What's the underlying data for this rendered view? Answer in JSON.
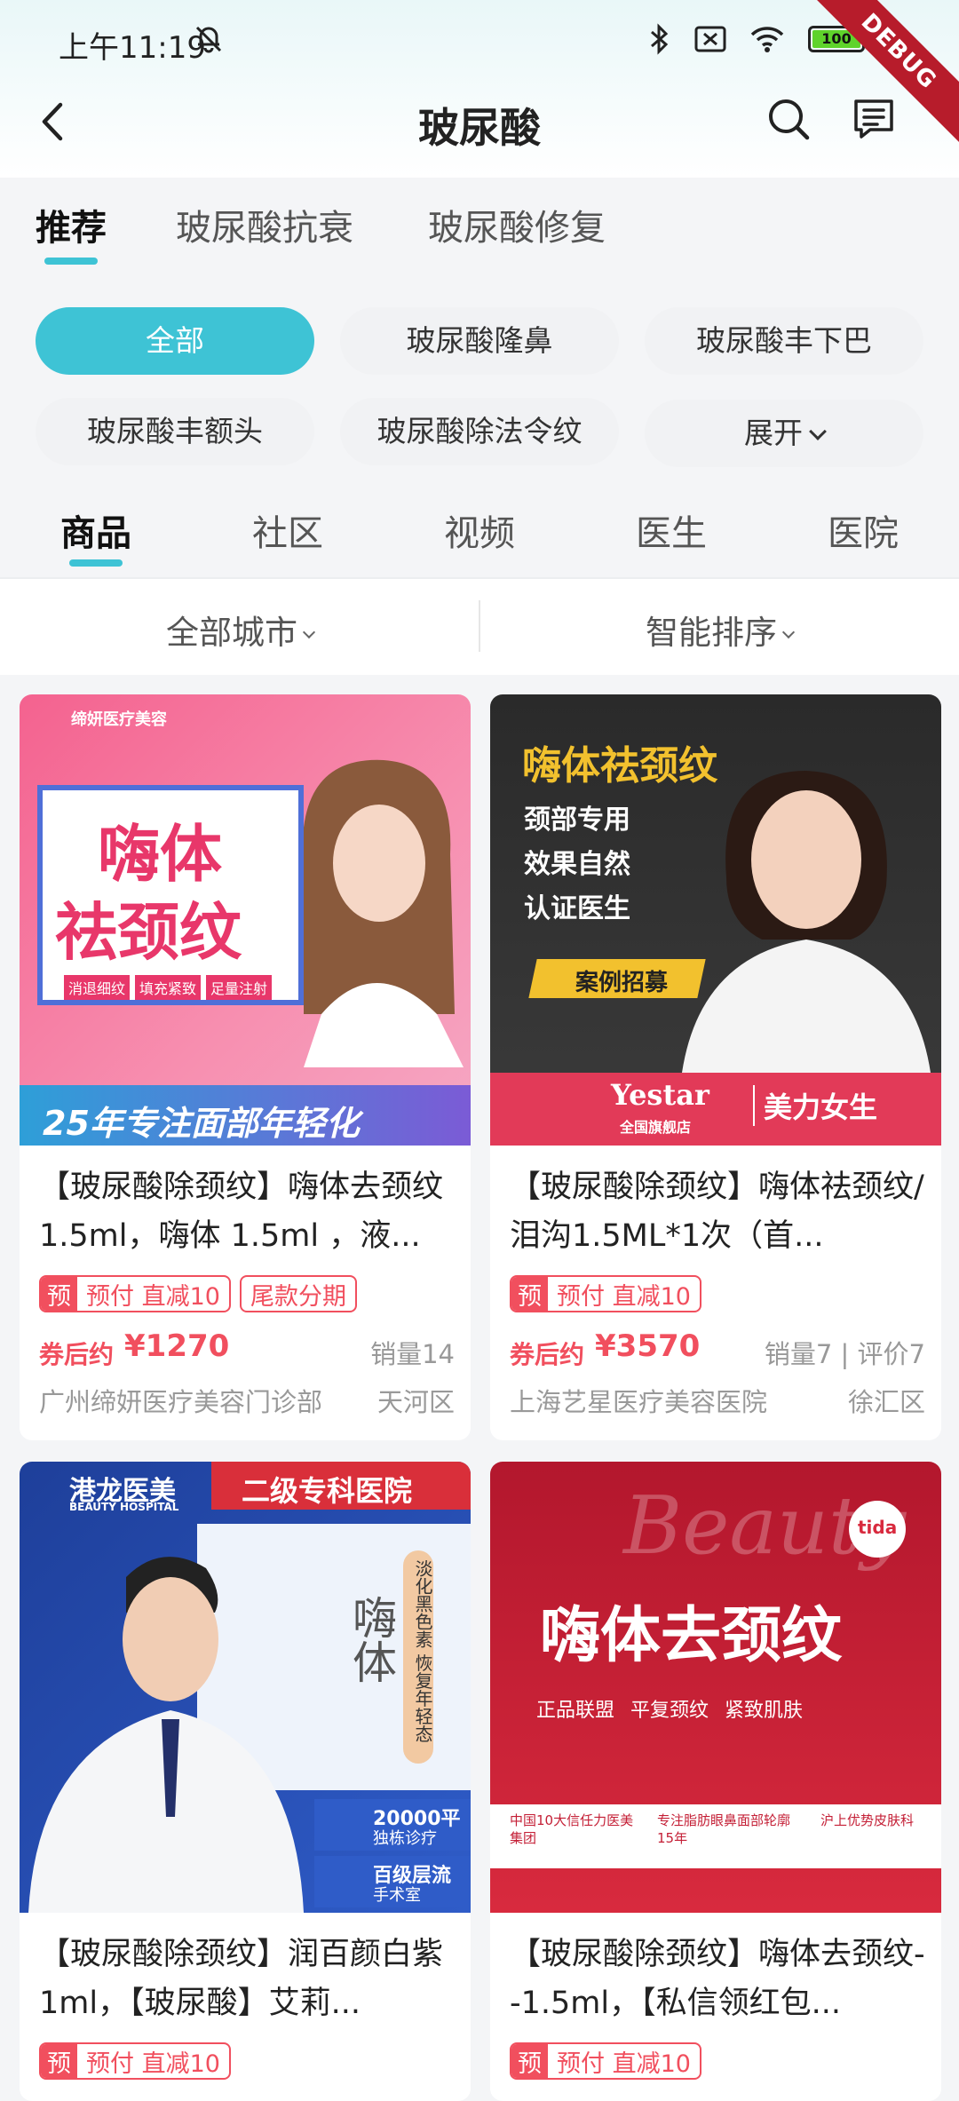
{
  "status_bar": {
    "time": "上午11:19",
    "battery": "100",
    "debug_label": "DEBUG"
  },
  "nav": {
    "title": "玻尿酸"
  },
  "category_tabs": [
    {
      "label": "推荐",
      "active": true
    },
    {
      "label": "玻尿酸抗衰",
      "active": false
    },
    {
      "label": "玻尿酸修复",
      "active": false
    }
  ],
  "chips": [
    {
      "label": "全部",
      "active": true
    },
    {
      "label": "玻尿酸隆鼻",
      "active": false
    },
    {
      "label": "玻尿酸丰下巴",
      "active": false
    },
    {
      "label": "玻尿酸丰额头",
      "active": false
    },
    {
      "label": "玻尿酸除法令纹",
      "active": false
    },
    {
      "label": "展开",
      "active": false
    }
  ],
  "sub_tabs": [
    {
      "label": "商品",
      "active": true
    },
    {
      "label": "社区",
      "active": false
    },
    {
      "label": "视频",
      "active": false
    },
    {
      "label": "医生",
      "active": false
    },
    {
      "label": "医院",
      "active": false
    }
  ],
  "filters": {
    "city": "全部城市",
    "sort": "智能排序"
  },
  "colors": {
    "accent": "#3ec3d5",
    "price": "#f14f5e"
  },
  "products": [
    {
      "title": "【玻尿酸除颈纹】嗨体去颈纹1.5ml，嗨体 1.5ml ，液...",
      "tags": [
        {
          "prefix": "预",
          "text": "预付 直减10"
        },
        {
          "prefix": "",
          "text": "尾款分期"
        }
      ],
      "coupon_label": "券后约",
      "price": "¥1270",
      "sales": "销量14",
      "hospital": "广州缔妍医疗美容门诊部",
      "area": "天河区",
      "image_texts": {
        "brand": "缔妍医疗美容",
        "headline1": "嗨体",
        "headline2": "祛颈纹",
        "badges": [
          "消退细纹",
          "填充紧致",
          "足量注射"
        ],
        "footer": "25年专注面部年轻化"
      }
    },
    {
      "title": "【玻尿酸除颈纹】嗨体祛颈纹/泪沟1.5ML*1次（首...",
      "tags": [
        {
          "prefix": "预",
          "text": "预付 直减10"
        }
      ],
      "coupon_label": "券后约",
      "price": "¥3570",
      "sales": "销量7 | 评价7",
      "hospital": "上海艺星医疗美容医院",
      "area": "徐汇区",
      "image_texts": {
        "headline": "嗨体祛颈纹",
        "lines": [
          "颈部专用",
          "效果自然",
          "认证医生"
        ],
        "badge": "案例招募",
        "brand": "Yestar",
        "brand_sub": "全国旗舰店",
        "slogan": "美力女生"
      }
    },
    {
      "title": "【玻尿酸除颈纹】润百颜白紫 1ml，【玻尿酸】艾莉...",
      "tags": [
        {
          "prefix": "预",
          "text": "预付 直减10"
        }
      ],
      "image_texts": {
        "brand": "港龙医美",
        "brand_en": "BEAUTY HOSPITAL",
        "banner": "二级专科医院",
        "side": "嗨体",
        "vertical": "淡化黑色素 恢复年轻态",
        "feature1": "20000平",
        "feature1_sub": "独栋诊疗",
        "feature2": "百级层流",
        "feature2_sub": "手术室"
      }
    },
    {
      "title": "【玻尿酸除颈纹】嗨体去颈纹--1.5ml，【私信领红包...",
      "tags": [
        {
          "prefix": "预",
          "text": "预付 直减10"
        }
      ],
      "image_texts": {
        "script": "Beauty",
        "logo": "tida",
        "headline": "嗨体去颈纹",
        "checks": [
          "正品联盟",
          "平复颈纹",
          "紧致肌肤"
        ],
        "bottom": [
          "中国10大信任力医美集团",
          "专注脂肪眼鼻面部轮廓15年",
          "沪上优势皮肤科"
        ]
      }
    }
  ]
}
